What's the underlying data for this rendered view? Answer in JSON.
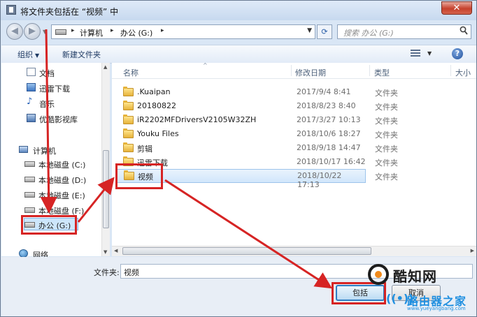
{
  "window": {
    "title": "将文件夹包括在 “视频” 中",
    "close_label": "✕"
  },
  "address": {
    "back_glyph": "◀",
    "forward_glyph": "▶",
    "nav_dropdown_glyph": "▼",
    "path_sep": "▸",
    "crumbs": [
      "计算机",
      "办公 (G:)"
    ],
    "path_dropdown_glyph": "▼",
    "refresh_glyph": "⟳",
    "search_placeholder": "搜索 办公 (G:)",
    "search_icon": "search-icon"
  },
  "toolbar": {
    "organize_label": "组织",
    "organize_drop": "▼",
    "new_folder_label": "新建文件夹",
    "view_drop": "▼",
    "help_label": "?"
  },
  "nav": {
    "items": [
      {
        "label": "文档",
        "icon": "document-icon"
      },
      {
        "label": "迅雷下载",
        "icon": "download-icon"
      },
      {
        "label": "音乐",
        "icon": "music-icon"
      },
      {
        "label": "优酷影视库",
        "icon": "video-library-icon"
      },
      {
        "label": "计算机",
        "icon": "computer-icon"
      },
      {
        "label": "本地磁盘 (C:)",
        "icon": "drive-icon"
      },
      {
        "label": "本地磁盘 (D:)",
        "icon": "drive-icon"
      },
      {
        "label": "本地磁盘 (E:)",
        "icon": "drive-icon"
      },
      {
        "label": "本地磁盘 (F:)",
        "icon": "drive-icon"
      },
      {
        "label": "办公 (G:)",
        "icon": "drive-icon"
      },
      {
        "label": "网络",
        "icon": "network-icon"
      }
    ],
    "selected": "办公 (G:)",
    "music_glyph": "♪",
    "scroll_up": "▲",
    "scroll_down": "▼"
  },
  "files": {
    "columns": {
      "name": "名称",
      "date": "修改日期",
      "type": "类型",
      "size": "大小"
    },
    "sort_glyph": "^",
    "rows": [
      {
        "name": ".Kuaipan",
        "date": "2017/9/4 8:41",
        "type": "文件夹"
      },
      {
        "name": "20180822",
        "date": "2018/8/23 8:40",
        "type": "文件夹"
      },
      {
        "name": "iR2202MFDriversV2105W32ZH",
        "date": "2017/3/27 10:13",
        "type": "文件夹"
      },
      {
        "name": "Youku Files",
        "date": "2018/10/6 18:27",
        "type": "文件夹"
      },
      {
        "name": "剪辑",
        "date": "2018/9/18 14:47",
        "type": "文件夹"
      },
      {
        "name": "迅雷下载",
        "date": "2018/10/17 16:42",
        "type": "文件夹"
      },
      {
        "name": "视频",
        "date": "2018/10/22 17:13",
        "type": "文件夹"
      }
    ],
    "selected": "视频",
    "hscroll_left": "◀",
    "hscroll_right": "▶"
  },
  "footer": {
    "folder_label": "文件夹:",
    "folder_value": "视频",
    "include_button": "包括",
    "cancel_button": "取消"
  },
  "watermark": {
    "brand": "酷知网",
    "brand2": "路由器之家",
    "url": "www.yueyangbang.com",
    "wifi_glyph": "((•))"
  },
  "colors": {
    "annotation_red": "#d62424",
    "selection_blue": "#cde6fb",
    "folder_yellow": "#e6b33a"
  }
}
